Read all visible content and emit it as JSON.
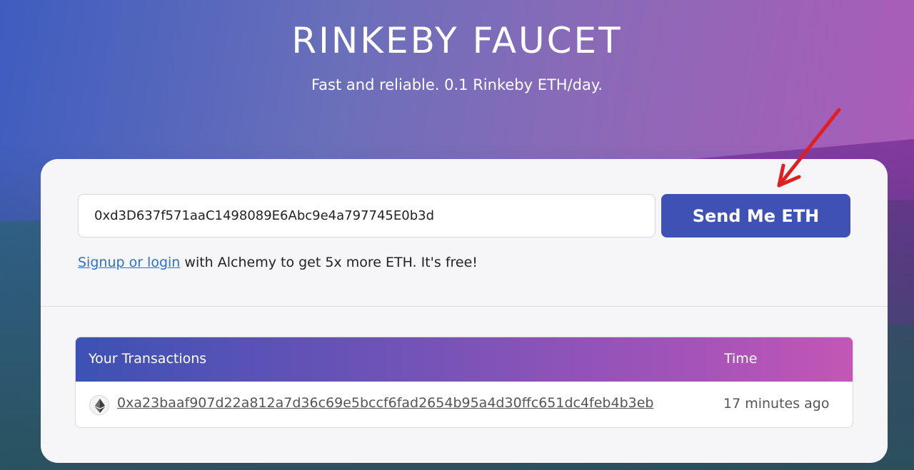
{
  "header": {
    "title": "RINKEBY FAUCET",
    "subtitle": "Fast and reliable. 0.1 Rinkeby ETH/day."
  },
  "form": {
    "address_value": "0xd3D637f571aaC1498089E6Abc9e4a797745E0b3d",
    "send_button_label": "Send Me ETH"
  },
  "signup": {
    "link_text": "Signup or login",
    "rest_text": " with Alchemy to get 5x more ETH. It's free!"
  },
  "transactions": {
    "header_tx": "Your Transactions",
    "header_time": "Time",
    "rows": [
      {
        "icon": "ethereum-icon",
        "hash": "0xa23baaf907d22a812a7d36c69e5bccf6fad2654b95a4d30ffc651dc4feb4b3eb",
        "time": "17 minutes ago"
      }
    ]
  },
  "colors": {
    "button": "#3f51b5",
    "link": "#2a72d0",
    "annotation_arrow": "#e02020"
  },
  "icons": {
    "annotation": "red-arrow-icon"
  }
}
